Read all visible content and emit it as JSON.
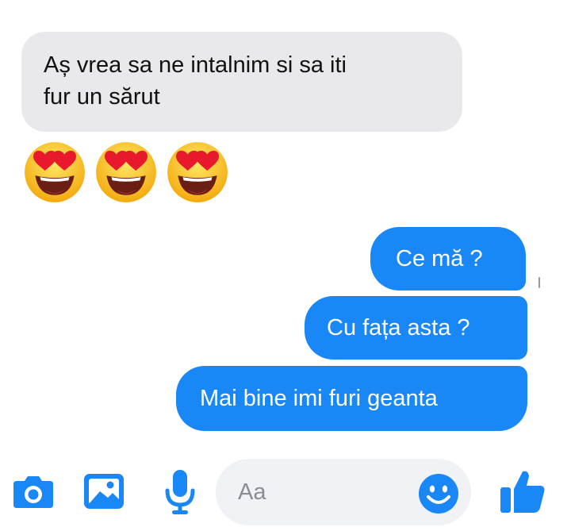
{
  "conversation": {
    "incoming": {
      "line1": "Aș vrea sa ne intalnim si sa iti",
      "line2": "fur un sărut"
    },
    "reaction_emojis": [
      "smiling-face-with-heart-eyes",
      "smiling-face-with-heart-eyes",
      "smiling-face-with-heart-eyes"
    ],
    "outgoing": [
      {
        "text": "Ce mă  ?"
      },
      {
        "text": "Cu fața asta ?"
      },
      {
        "text": "Mai bine imi furi geanta"
      }
    ]
  },
  "composer": {
    "placeholder": "Aa",
    "icons": [
      "camera-icon",
      "image-icon",
      "microphone-icon",
      "emoji-icon",
      "thumbs-up-icon"
    ]
  },
  "colors": {
    "outgoing_bubble": "#1a87f6",
    "incoming_bubble": "#e9e9eb",
    "icon_accent": "#1a87f6",
    "composer_bg": "#f1f2f5"
  }
}
